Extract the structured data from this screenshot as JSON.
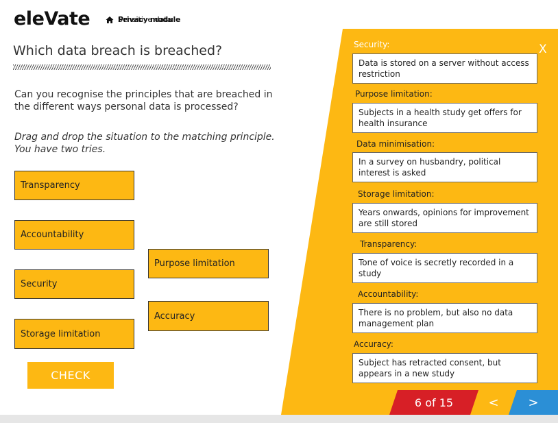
{
  "header": {
    "logo": "eleVate",
    "breadcrumb_module": "Privacy module",
    "breadcrumb_topic": "Sensitive data"
  },
  "main": {
    "title": "Which data breach is breached?",
    "intro": "Can you recognise the principles that are breached in the different ways personal data is processed?",
    "instructions": "Drag and drop the situation to the matching principle. You have two tries."
  },
  "tiles": {
    "transparency": "Transparency",
    "accountability": "Accountability",
    "security": "Security",
    "storage_limitation": "Storage limitation",
    "purpose_limitation": "Purpose limitation",
    "accuracy": "Accuracy"
  },
  "check_label": "CHECK",
  "panel": {
    "close": "X",
    "slots": [
      {
        "label": "Security:",
        "text": "Data is stored on a server without access restriction"
      },
      {
        "label": "Purpose limitation:",
        "text": "Subjects in a health study get offers for health insurance"
      },
      {
        "label": "Data minimisation:",
        "text": "In a survey on husbandry, political interest is asked"
      },
      {
        "label": "Storage limitation:",
        "text": "Years onwards, opinions for improvement are still stored"
      },
      {
        "label": "Transparency:",
        "text": "Tone of voice is secretly recorded in a study"
      },
      {
        "label": "Accountability:",
        "text": "There is no problem, but also no data management plan"
      },
      {
        "label": "Accuracy:",
        "text": "Subject has retracted consent, but appears in a new study"
      }
    ]
  },
  "pager": {
    "count": "6 of 15",
    "prev": "<",
    "next": ">"
  },
  "colors": {
    "accent": "#fdb813",
    "counter": "#d71f26",
    "next": "#2b8fd6"
  }
}
